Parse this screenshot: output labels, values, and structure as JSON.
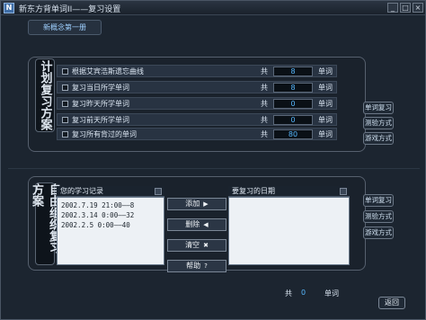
{
  "window": {
    "title": "新东方背单词II——复习设置",
    "icon_text": "N",
    "min_label": "_",
    "max_label": "□",
    "close_label": "×"
  },
  "book_tab": "新概念第一册",
  "plan": {
    "label": "计划复习方案",
    "rows": [
      {
        "label": "根据艾宾浩斯遗忘曲线",
        "gong": "共",
        "value": "8",
        "unit": "单词"
      },
      {
        "label": "复习当日所学单词",
        "gong": "共",
        "value": "8",
        "unit": "单词"
      },
      {
        "label": "复习昨天所学单词",
        "gong": "共",
        "value": "0",
        "unit": "单词"
      },
      {
        "label": "复习前天所学单词",
        "gong": "共",
        "value": "0",
        "unit": "单词"
      },
      {
        "label": "复习所有背过的单词",
        "gong": "共",
        "value": "80",
        "unit": "单词"
      }
    ],
    "side_buttons": [
      "单词复习",
      "测验方式",
      "游戏方式"
    ]
  },
  "custom": {
    "label": "自由组织复习方案",
    "records_header": "您的学习记录",
    "records": [
      "2002.7.19 21:00——8",
      "2002.3.14 0:00——32",
      "2002.2.5 0:00——40"
    ],
    "dates_header": "要复习的日期",
    "actions": [
      {
        "label": "添加",
        "icon": "▶"
      },
      {
        "label": "删除",
        "icon": "◀"
      },
      {
        "label": "清空",
        "icon": "✖"
      },
      {
        "label": "帮助",
        "icon": "?"
      }
    ],
    "side_buttons": [
      "单词复习",
      "测验方式",
      "游戏方式"
    ]
  },
  "footer": {
    "gong": "共",
    "count": "0",
    "unit": "单词",
    "back_label": "返回"
  }
}
